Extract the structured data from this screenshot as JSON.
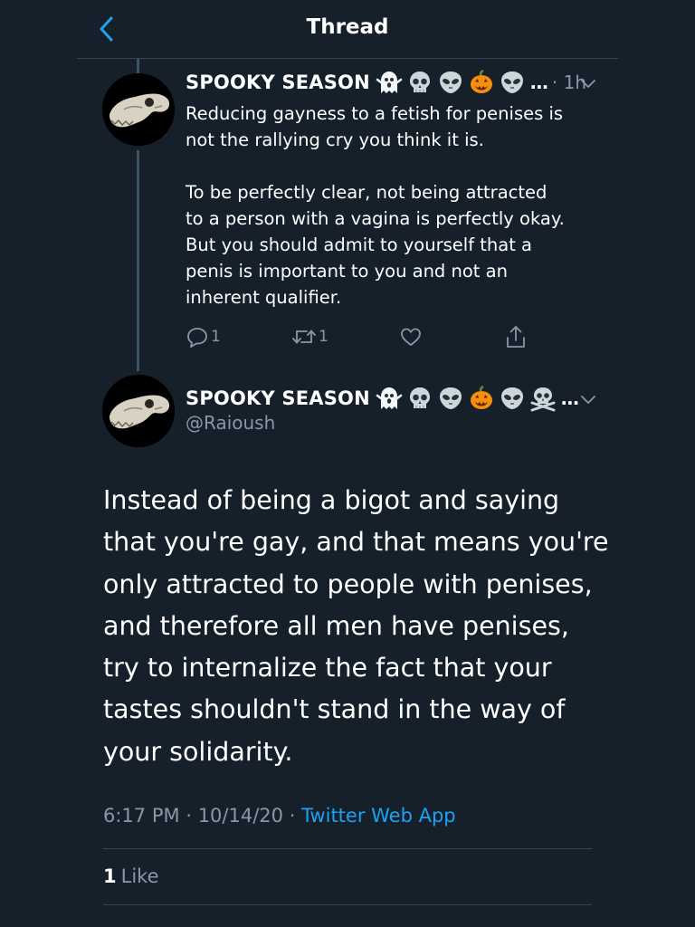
{
  "header": {
    "title": "Thread",
    "back_icon": "chevron-left-icon"
  },
  "colors": {
    "background": "#15202b",
    "text": "#ffffff",
    "muted": "#8899a6",
    "accent": "#1da1f2",
    "divider": "#38444d"
  },
  "parent_tweet": {
    "display_name": "SPOOKY SEASON",
    "emojis": [
      "ghost",
      "skull",
      "alien",
      "jack-o-lantern",
      "alien"
    ],
    "ellipsis": "…",
    "time": "· 1h",
    "text": "Reducing gayness to a fetish for penises is\nnot the rallying cry you think it is.\n\nTo be perfectly clear, not being attracted\nto a person with a vagina is perfectly okay.\nBut you should admit to yourself that a\npenis is important to you and not an\ninherent qualifier.",
    "actions": {
      "reply_count": "1",
      "retweet_count": "1",
      "like_count": "",
      "share_label": ""
    }
  },
  "main_tweet": {
    "display_name": "SPOOKY SEASON",
    "emojis": [
      "ghost",
      "skull",
      "alien",
      "jack-o-lantern",
      "alien",
      "skull-and-crossbones"
    ],
    "ellipsis": "…",
    "handle": "@Raioush",
    "text": "Instead of being a bigot and saying that you're gay, and that means you're only attracted to people with penises, and therefore all men have penises, try to internalize the fact that your tastes shouldn't stand in the way of your solidarity.",
    "time": "6:17 PM",
    "date": "10/14/20",
    "separator": "·",
    "source": "Twitter Web App",
    "like_count": "1",
    "like_label": "Like"
  }
}
